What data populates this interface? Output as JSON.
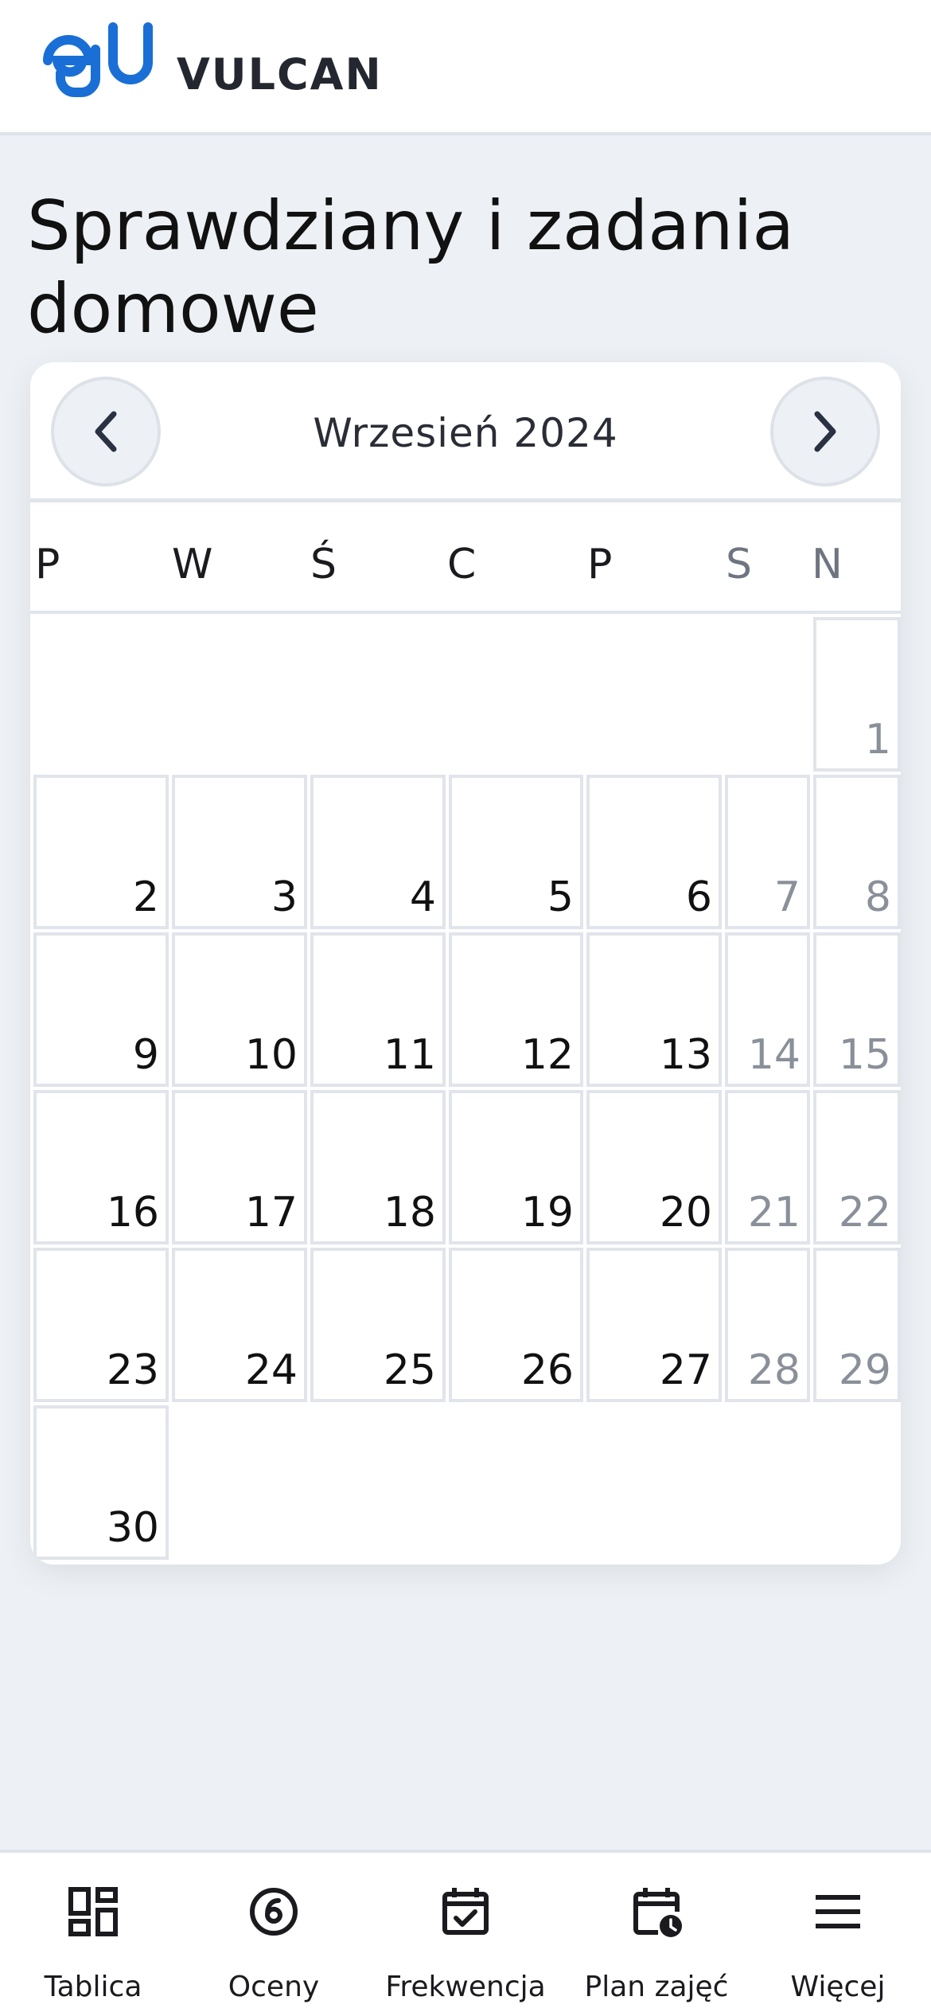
{
  "header": {
    "brand": "VULCAN",
    "logo_text": "edu"
  },
  "page": {
    "title": "Sprawdziany i zadania domowe"
  },
  "calendar": {
    "month_label": "Wrzesień 2024",
    "weekdays": [
      "P",
      "W",
      "Ś",
      "C",
      "P",
      "S",
      "N"
    ],
    "weeks": [
      [
        "",
        "",
        "",
        "",
        "",
        "",
        "1"
      ],
      [
        "2",
        "3",
        "4",
        "5",
        "6",
        "7",
        "8"
      ],
      [
        "9",
        "10",
        "11",
        "12",
        "13",
        "14",
        "15"
      ],
      [
        "16",
        "17",
        "18",
        "19",
        "20",
        "21",
        "22"
      ],
      [
        "23",
        "24",
        "25",
        "26",
        "27",
        "28",
        "29"
      ],
      [
        "30",
        "",
        "",
        "",
        "",
        "",
        ""
      ]
    ]
  },
  "bottom_nav": [
    {
      "label": "Tablica",
      "icon": "dashboard-icon"
    },
    {
      "label": "Oceny",
      "icon": "grade-icon"
    },
    {
      "label": "Frekwencja",
      "icon": "calendar-check-icon"
    },
    {
      "label": "Plan zajęć",
      "icon": "calendar-clock-icon"
    },
    {
      "label": "Więcej",
      "icon": "menu-icon"
    }
  ],
  "colors": {
    "brand_blue": "#1a6fd6",
    "background": "#edf0f5",
    "weekend_text": "#8a9099"
  }
}
